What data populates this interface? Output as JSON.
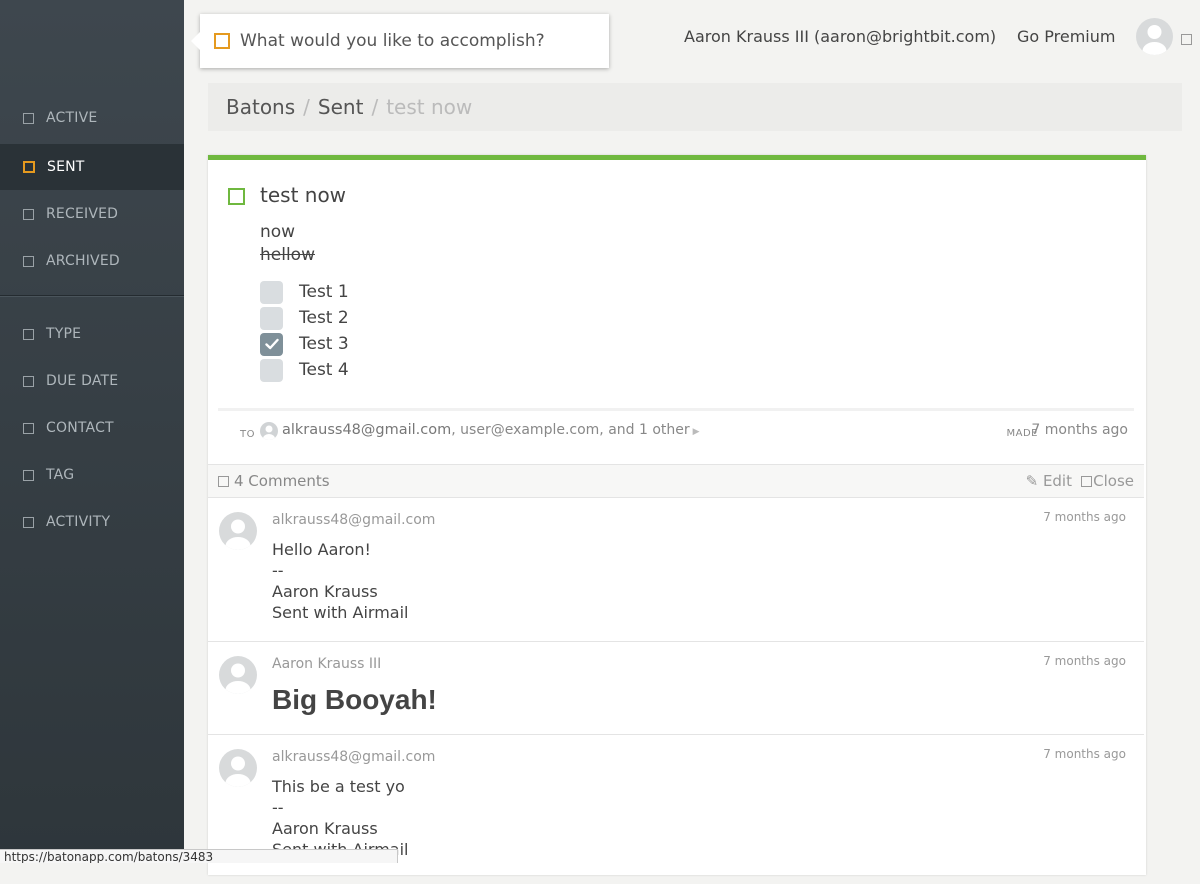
{
  "goal": {
    "placeholder": "What would you like to accomplish?"
  },
  "header": {
    "user": "Aaron Krauss III (aaron@brightbit.com)",
    "premium": "Go Premium"
  },
  "sidebar": {
    "items": [
      {
        "label": "ACTIVE"
      },
      {
        "label": "SENT"
      },
      {
        "label": "RECEIVED"
      },
      {
        "label": "ARCHIVED"
      }
    ],
    "filters": [
      {
        "label": "TYPE"
      },
      {
        "label": "DUE DATE"
      },
      {
        "label": "CONTACT"
      },
      {
        "label": "TAG"
      },
      {
        "label": "ACTIVITY"
      }
    ]
  },
  "breadcrumb": {
    "root": "Batons",
    "section": "Sent",
    "current": "test now"
  },
  "baton": {
    "title": "test now",
    "description": [
      "now",
      "hellow"
    ],
    "checklist": [
      {
        "label": "Test 1",
        "checked": false
      },
      {
        "label": "Test 2",
        "checked": false
      },
      {
        "label": "Test 3",
        "checked": true
      },
      {
        "label": "Test 4",
        "checked": false
      }
    ],
    "to_label": "TO",
    "recipient_first": "alkrauss48@gmail.com",
    "recipient_rest": ", user@example.com, and 1 other",
    "made_label": "MADE",
    "made_time": "7 months ago"
  },
  "comments_bar": {
    "count": "4 Comments",
    "edit": "Edit",
    "close": "Close"
  },
  "comments": [
    {
      "author": "alkrauss48@gmail.com",
      "time": "7 months ago",
      "lines": [
        "Hello Aaron!",
        "--",
        "Aaron Krauss",
        "Sent with Airmail"
      ]
    },
    {
      "author": "Aaron Krauss III",
      "time": "7 months ago",
      "big": "Big Booyah!"
    },
    {
      "author": "alkrauss48@gmail.com",
      "time": "7 months ago",
      "lines": [
        "This be a test yo",
        "--",
        "Aaron Krauss",
        "Sent with Airmail"
      ]
    }
  ],
  "status_bar": {
    "url": "https://batonapp.com/batons/3483"
  },
  "colors": {
    "accent_orange": "#e59a1f",
    "accent_green": "#6fb83f",
    "sidebar_bg": "#3e474e"
  }
}
